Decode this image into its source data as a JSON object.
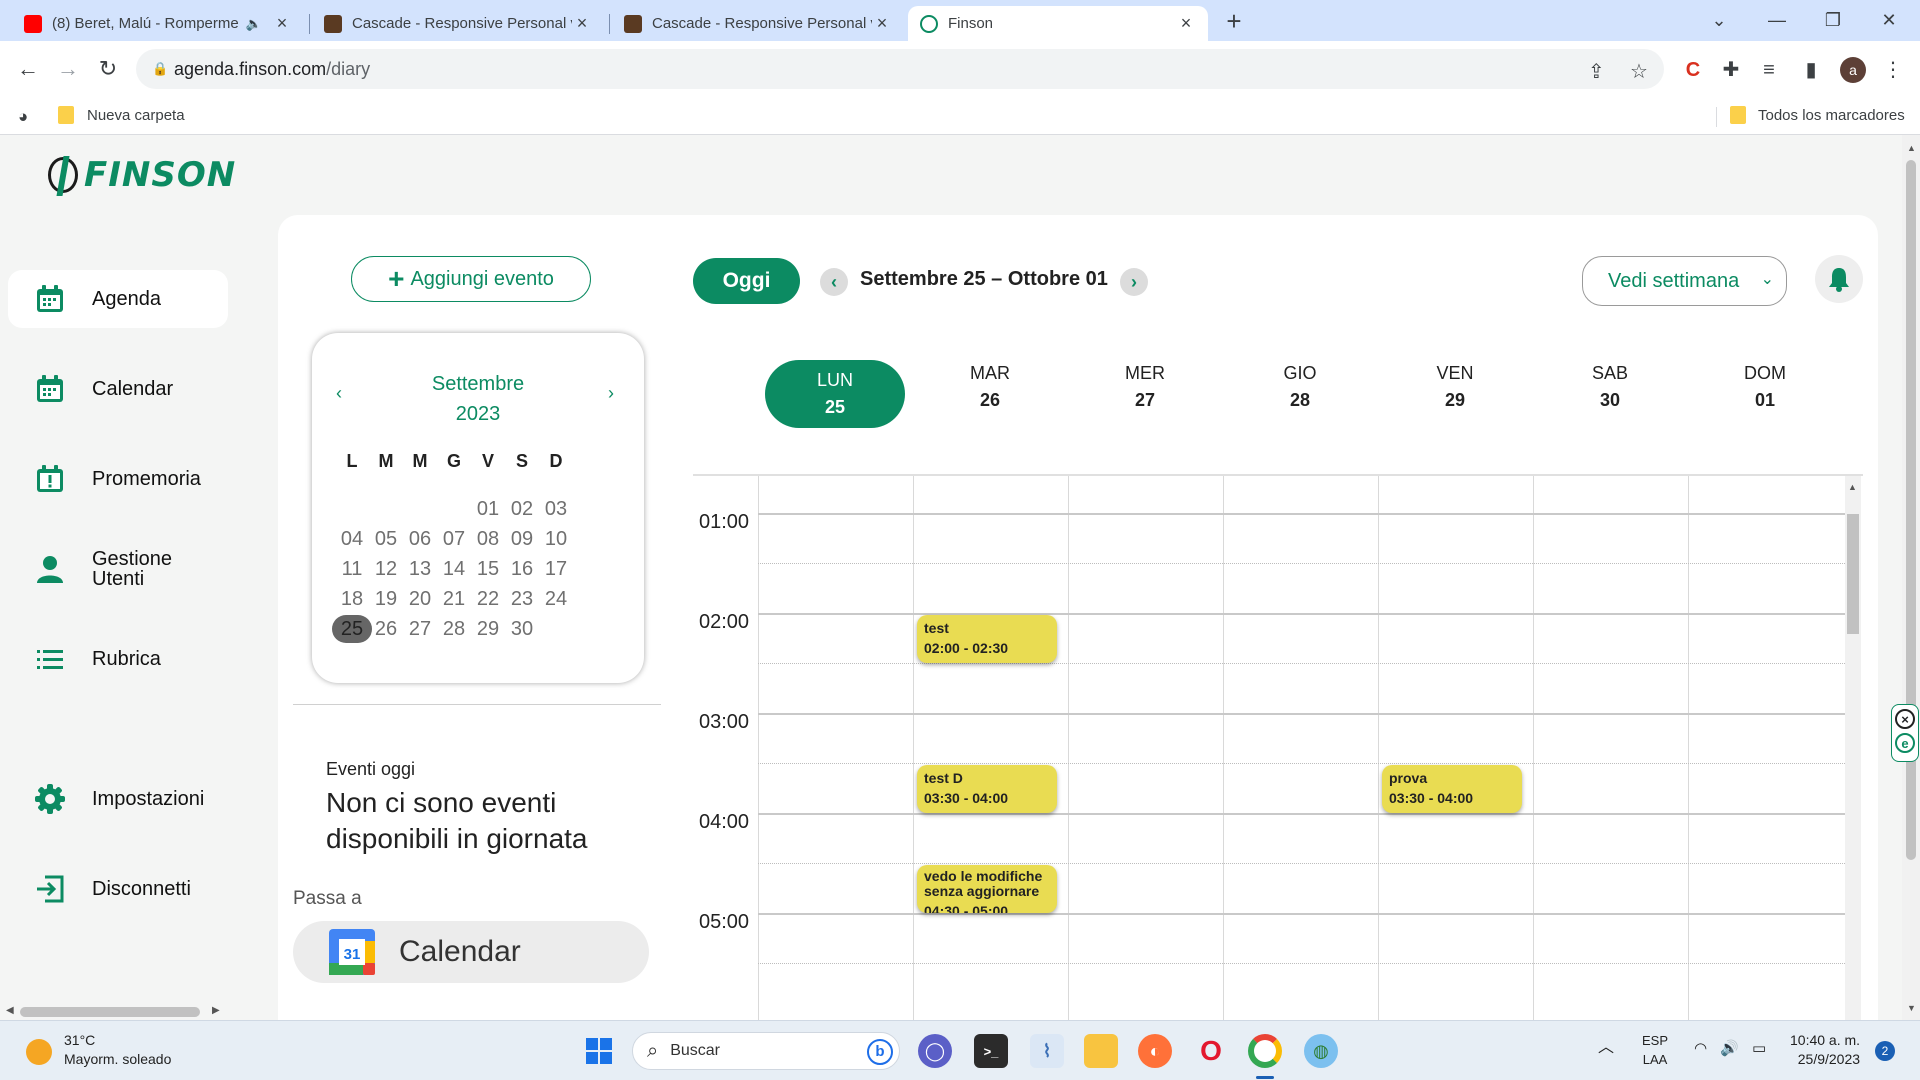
{
  "browser": {
    "tabs": [
      {
        "title": "(8) Beret, Malú - Romperme",
        "muted_icon": "🔈",
        "favicon": "youtube-icon"
      },
      {
        "title": "Cascade - Responsive Personal v",
        "favicon": "cascade-icon"
      },
      {
        "title": "Cascade - Responsive Personal v",
        "favicon": "cascade-icon"
      },
      {
        "title": "Finson",
        "favicon": "finson-icon",
        "active": true
      }
    ],
    "new_tab": "+",
    "url_host": "agenda.finson.com",
    "url_path": "/diary",
    "profile_initial": "a",
    "bookmarks": {
      "folder": "Nueva carpeta",
      "all": "Todos los marcadores"
    }
  },
  "app": {
    "logo_text": "FINSON",
    "colors": {
      "brand": "#0c8b62",
      "event": "#e9dc52"
    },
    "sidebar": [
      {
        "label": "Agenda",
        "icon": "calendar-icon",
        "active": true
      },
      {
        "label": "Calendar",
        "icon": "calendar-icon"
      },
      {
        "label": "Promemoria",
        "icon": "reminder-icon"
      },
      {
        "label": "Gestione Utenti",
        "icon": "user-icon"
      },
      {
        "label": "Rubrica",
        "icon": "list-icon"
      },
      {
        "label": "Impostazioni",
        "icon": "gear-icon"
      },
      {
        "label": "Disconnetti",
        "icon": "logout-icon"
      }
    ],
    "add_event": "Aggiungi evento",
    "mini_calendar": {
      "month": "Settembre",
      "year": "2023",
      "weekdays": [
        "L",
        "M",
        "M",
        "G",
        "V",
        "S",
        "D"
      ],
      "weeks": [
        [
          "",
          "",
          "",
          "",
          "01",
          "02",
          "03"
        ],
        [
          "04",
          "05",
          "06",
          "07",
          "08",
          "09",
          "10"
        ],
        [
          "11",
          "12",
          "13",
          "14",
          "15",
          "16",
          "17"
        ],
        [
          "18",
          "19",
          "20",
          "21",
          "22",
          "23",
          "24"
        ],
        [
          "25",
          "26",
          "27",
          "28",
          "29",
          "30",
          ""
        ]
      ],
      "today": "25"
    },
    "events_today": {
      "label": "Eventi oggi",
      "message": "Non ci sono eventi disponibili in giornata"
    },
    "passa_a": "Passa a",
    "calendar_link": {
      "label": "Calendar",
      "icon_number": "31"
    },
    "toolbar": {
      "today": "Oggi",
      "range": "Settembre 25 – Ottobre 01",
      "view": "Vedi settimana"
    },
    "days": [
      {
        "name": "LUN",
        "num": "25",
        "active": true
      },
      {
        "name": "MAR",
        "num": "26"
      },
      {
        "name": "MER",
        "num": "27"
      },
      {
        "name": "GIO",
        "num": "28"
      },
      {
        "name": "VEN",
        "num": "29"
      },
      {
        "name": "SAB",
        "num": "30"
      },
      {
        "name": "DOM",
        "num": "01"
      }
    ],
    "hours": [
      "01:00",
      "02:00",
      "03:00",
      "04:00",
      "05:00"
    ],
    "events": [
      {
        "title": "test",
        "time": "02:00 - 02:30",
        "day": "MAR"
      },
      {
        "title": "test D",
        "time": "03:30 - 04:00",
        "day": "MAR"
      },
      {
        "title": "vedo le modifiche senza aggiornare",
        "time": "04:30 - 05:00",
        "day": "MAR"
      },
      {
        "title": "prova",
        "time": "03:30 - 04:00",
        "day": "VEN"
      }
    ]
  },
  "taskbar": {
    "weather_temp": "31°C",
    "weather_desc": "Mayorm. soleado",
    "search": "Buscar",
    "lang_top": "ESP",
    "lang_bottom": "LAA",
    "time": "10:40 a. m.",
    "date": "25/9/2023",
    "notifications": "2"
  }
}
